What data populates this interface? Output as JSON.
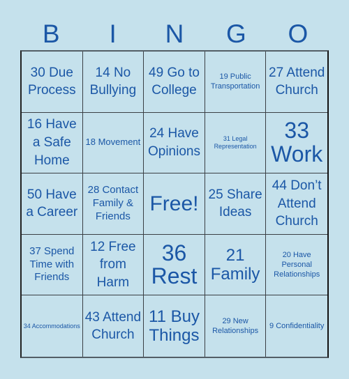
{
  "header": {
    "letters": [
      "B",
      "I",
      "N",
      "G",
      "O"
    ]
  },
  "colors": {
    "background": "#c5e1ec",
    "text": "#1b57a6",
    "grid": "#3a3f44"
  },
  "board": {
    "cells": [
      "30 Due Process",
      "14 No Bullying",
      "49 Go to College",
      "19 Public Transportation",
      "27 Attend Church",
      "16 Have a Safe Home",
      "18 Movement",
      "24 Have Opinions",
      "31 Legal Representation",
      "33 Work",
      "50 Have a Career",
      "28 Contact Family & Friends",
      "Free!",
      "25 Share Ideas",
      "44 Don’t Attend Church",
      "37 Spend Time with Friends",
      "12 Free from Harm",
      "36 Rest",
      "21 Family",
      "20 Have Personal Relationships",
      "34 Accommodations",
      "43 Attend Church",
      "11 Buy Things",
      "29 New Relationships",
      "9 Confidentiality"
    ]
  }
}
